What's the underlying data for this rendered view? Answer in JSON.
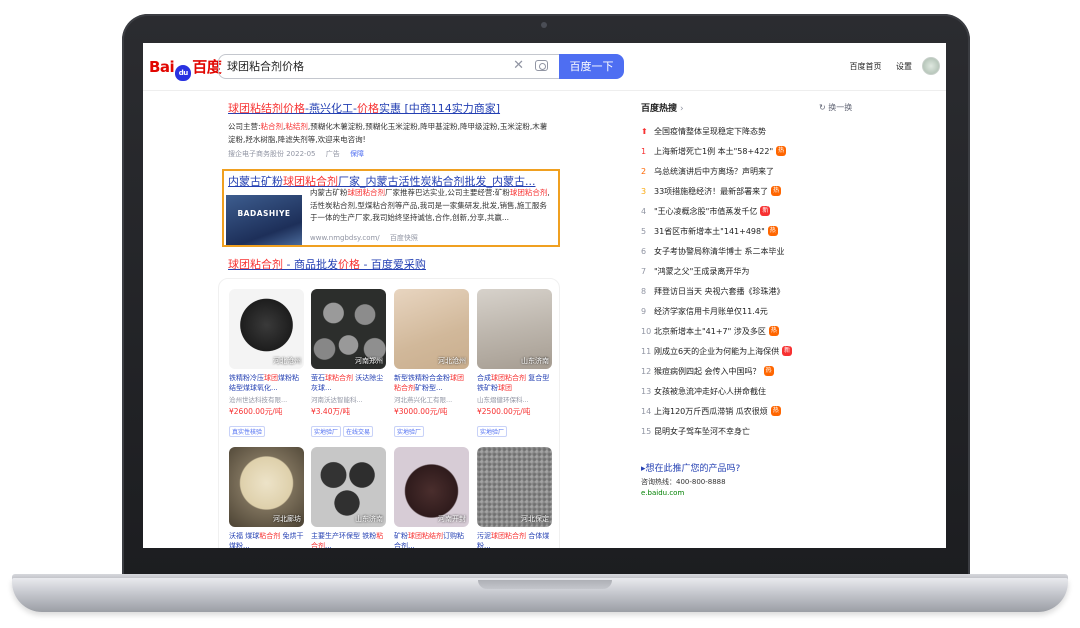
{
  "header": {
    "logo_text_left": "Bai",
    "logo_paw": "du",
    "logo_text_right": "百度",
    "search_value": "球团粘合剂价格",
    "search_button": "百度一下",
    "link_home": "百度首页",
    "link_settings": "设置"
  },
  "results": [
    {
      "title_parts": [
        "球团粘结剂价格",
        "-燕兴化工-",
        "价格",
        "实惠 [中商114实力商家]"
      ],
      "desc_line1_parts": [
        "公司主营:",
        "粘合剂",
        ",",
        "粘结剂",
        ",预糊化木薯淀粉,预糊化玉米淀粉,降甲基淀粉,降甲级淀粉,玉米淀粉,木薯"
      ],
      "desc_line2": "淀粉,羟水树脂,降滤失剂等,欢迎来电咨询!",
      "source": "搜企电子商务股份 2022-05",
      "ad": "广告",
      "bao": "保障"
    },
    {
      "title_parts": [
        "内蒙古矿粉",
        "球团粘合剂",
        "厂家_内蒙古活性炭粘合剂批发_内蒙古..."
      ],
      "thumb_text": "BADASHIYE",
      "desc_parts": [
        "内蒙古矿粉",
        "球团粘合剂",
        "厂家推荐巴达实业,公司主要经营:矿粉",
        "球团粘合剂",
        ",活性炭粘合剂,型煤粘合剂等产品,我司是一家集研发,批发,销售,施工服务于一体的生产厂家,我司始终坚持诚信,合作,创新,分享,共赢..."
      ],
      "source": "www.nmgbdsy.com/",
      "snapshot": "百度快照"
    },
    {
      "title_parts": [
        "球团粘合剂",
        " - 商品批发",
        "价格",
        " - 百度爱采购"
      ]
    }
  ],
  "products": [
    {
      "name_parts": [
        "铁精粉冷压",
        "球团",
        "煤粉粘结型煤球氧化..."
      ],
      "company": "沧州世达科技有限...",
      "price": "¥2600.00元/吨",
      "badges": [
        "真实性核验"
      ],
      "location": "河北沧州"
    },
    {
      "name_parts": [
        "萤石",
        "球粘合剂",
        " 沃达除尘灰球..."
      ],
      "company": "河南沃达智能科...",
      "price": "¥3.40万/吨",
      "badges": [
        "实地验厂",
        "在线交易"
      ],
      "location": "河南郑州"
    },
    {
      "name_parts": [
        "新型铁精粉合金粉",
        "球团粘合剂",
        "矿粉型..."
      ],
      "company": "河北燕兴化工有限...",
      "price": "¥3000.00元/吨",
      "badges": [
        "实地验厂"
      ],
      "location": "河北沧州"
    },
    {
      "name_parts": [
        "合成",
        "球团粘合剂",
        " 复合型铁矿粉",
        "球团"
      ],
      "company": "山东熠健环保科...",
      "price": "¥2500.00元/吨",
      "badges": [
        "实地验厂"
      ],
      "location": "山东济南"
    },
    {
      "name_parts": [
        "沃福 煤球",
        "粘合剂",
        " 免烘干煤粉..."
      ],
      "company": "",
      "price": "",
      "badges": [],
      "location": "河北廊坊"
    },
    {
      "name_parts": [
        "主要生产环保型 铁粉",
        "粘合剂",
        "..."
      ],
      "company": "",
      "price": "",
      "badges": [],
      "location": "山东济南"
    },
    {
      "name_parts": [
        "矿粉",
        "球团粘结剂",
        "订购粘合剂..."
      ],
      "company": "",
      "price": "",
      "badges": [],
      "location": "河南开封"
    },
    {
      "name_parts": [
        "污泥",
        "球团粘合剂",
        " 合体煤粉..."
      ],
      "company": "",
      "price": "",
      "badges": [],
      "location": "河北保定"
    }
  ],
  "hot": {
    "title": "百度热搜",
    "refresh": "换一换",
    "items": [
      {
        "num": "⬆",
        "text": "全国疫情整体呈现稳定下降态势",
        "badge": ""
      },
      {
        "num": "1",
        "text": "上海新增死亡1例 本土\"58+422\"",
        "badge": "热"
      },
      {
        "num": "2",
        "text": "乌总统演讲后中方离场？声明来了",
        "badge": ""
      },
      {
        "num": "3",
        "text": "33项措施稳经济！最新部署来了",
        "badge": "热"
      },
      {
        "num": "4",
        "text": "\"王心凌概念股\"市值蒸发千亿",
        "badge": "新"
      },
      {
        "num": "5",
        "text": "31省区市新增本土\"141+498\"",
        "badge": "热"
      },
      {
        "num": "6",
        "text": "女子考协警局称清华博士 系二本毕业",
        "badge": ""
      },
      {
        "num": "7",
        "text": "\"鸿蒙之父\"王成录离开华为",
        "badge": ""
      },
      {
        "num": "8",
        "text": "拜登访日当天 央视六套播《珍珠港》",
        "badge": ""
      },
      {
        "num": "9",
        "text": "经济学家信用卡月账单仅11.4元",
        "badge": ""
      },
      {
        "num": "10",
        "text": "北京新增本土\"41+7\" 涉及多区",
        "badge": "热"
      },
      {
        "num": "11",
        "text": "刚成立6天的企业为何能为上海保供",
        "badge": "新"
      },
      {
        "num": "12",
        "text": "猴痘病例四起 会传入中国吗？",
        "badge": "热"
      },
      {
        "num": "13",
        "text": "女孩被急流冲走好心人拼命截住",
        "badge": ""
      },
      {
        "num": "14",
        "text": "上海120万斤西瓜滞销 瓜农很烦",
        "badge": "热"
      },
      {
        "num": "15",
        "text": "昆明女子驾车坠河不幸身亡",
        "badge": ""
      }
    ]
  },
  "promo": {
    "title": "▸想在此推广您的产品吗?",
    "phone": "咨询热线：400-800-8888",
    "url": "e.baidu.com"
  },
  "colors": {
    "accent": "#4e6ef2",
    "link": "#2440b3",
    "highlight": "#f73131",
    "frame_highlight": "#f0a020"
  }
}
